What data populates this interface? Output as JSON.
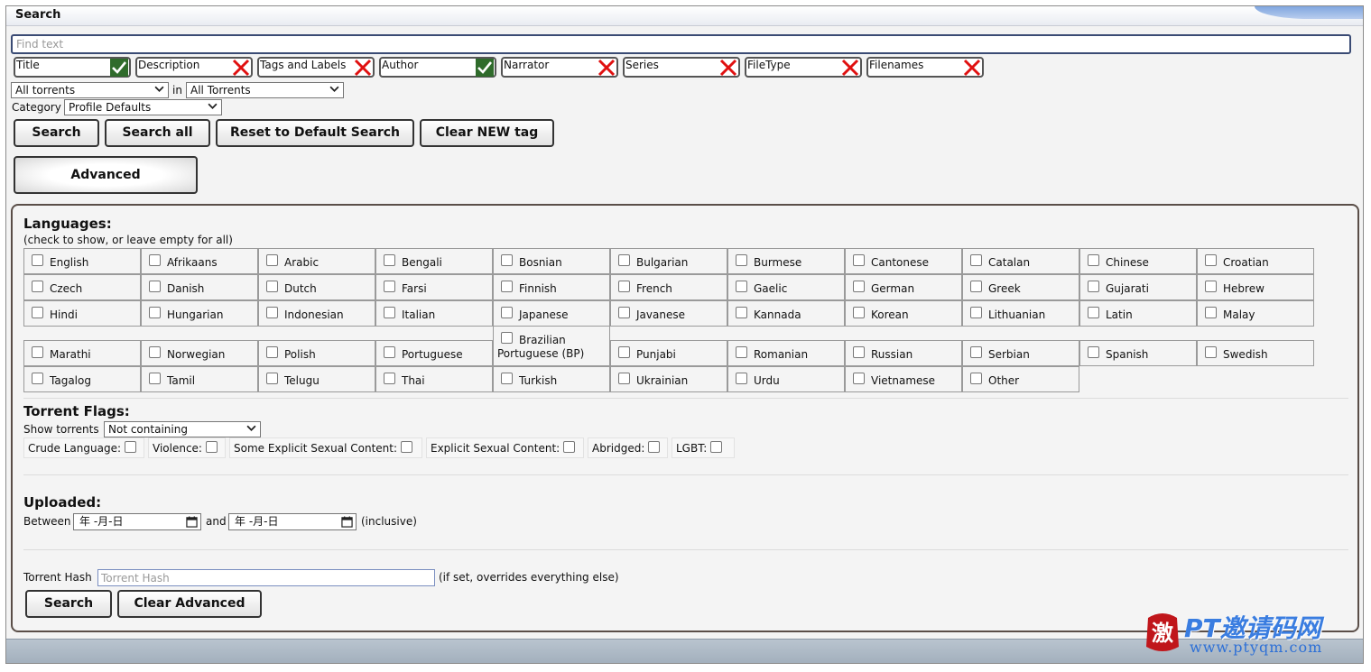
{
  "header": {
    "title": "Search"
  },
  "search": {
    "find_placeholder": "Find text",
    "fields": [
      {
        "label": "Title",
        "checked": true
      },
      {
        "label": "Description",
        "checked": false
      },
      {
        "label": "Tags and Labels",
        "checked": false
      },
      {
        "label": "Author",
        "checked": true
      },
      {
        "label": "Narrator",
        "checked": false
      },
      {
        "label": "Series",
        "checked": false
      },
      {
        "label": "FileType",
        "checked": false
      },
      {
        "label": "Filenames",
        "checked": false
      }
    ],
    "scope_select": "All torrents",
    "in_label": "in",
    "target_select": "All Torrents",
    "category_label": "Category",
    "category_select": "Profile Defaults",
    "buttons": {
      "search": "Search",
      "search_all": "Search all",
      "reset": "Reset to Default Search",
      "clear_new": "Clear NEW tag",
      "advanced": "Advanced"
    }
  },
  "advanced": {
    "languages_title": "Languages:",
    "languages_hint": "(check to show, or leave empty for all)",
    "languages": [
      "English",
      "Afrikaans",
      "Arabic",
      "Bengali",
      "Bosnian",
      "Bulgarian",
      "Burmese",
      "Cantonese",
      "Catalan",
      "Chinese",
      "Croatian",
      "Czech",
      "Danish",
      "Dutch",
      "Farsi",
      "Finnish",
      "French",
      "Gaelic",
      "German",
      "Greek",
      "Gujarati",
      "Hebrew",
      "Hindi",
      "Hungarian",
      "Indonesian",
      "Italian",
      "Japanese",
      "Javanese",
      "Kannada",
      "Korean",
      "Lithuanian",
      "Latin",
      "Malay",
      "Marathi",
      "Norwegian",
      "Polish",
      "Portuguese",
      "Brazilian Portuguese (BP)",
      "Punjabi",
      "Romanian",
      "Russian",
      "Serbian",
      "Spanish",
      "Swedish",
      "Tagalog",
      "Tamil",
      "Telugu",
      "Thai",
      "Turkish",
      "Ukrainian",
      "Urdu",
      "Vietnamese",
      "Other"
    ],
    "flags_title": "Torrent Flags:",
    "show_torrents_label": "Show torrents",
    "show_torrents_select": "Not containing",
    "flags": [
      "Crude Language:",
      "Violence:",
      "Some Explicit Sexual Content:",
      "Explicit Sexual Content:",
      "Abridged:",
      "LGBT:"
    ],
    "uploaded_title": "Uploaded:",
    "between_label": "Between",
    "date_from": "年 -月-日",
    "and_label": "and",
    "date_to": "年 -月-日",
    "inclusive_label": "(inclusive)",
    "hash_label": "Torrent Hash",
    "hash_placeholder": "Torrent Hash",
    "hash_note": "(if set, overrides everything else)",
    "search_button": "Search",
    "clear_button": "Clear Advanced"
  },
  "watermark": {
    "text": "PT邀请码网",
    "url": "www.ptyqm.com",
    "seal_char": "激"
  },
  "colors": {
    "check": "#2f6b2b",
    "cross": "#e01010",
    "accent": "#3a4b74",
    "border": "#5a4e48"
  },
  "icons": {
    "checked": "check-icon",
    "unchecked": "cross-icon",
    "dropdown": "chevron-down-icon",
    "date": "calendar-icon"
  }
}
